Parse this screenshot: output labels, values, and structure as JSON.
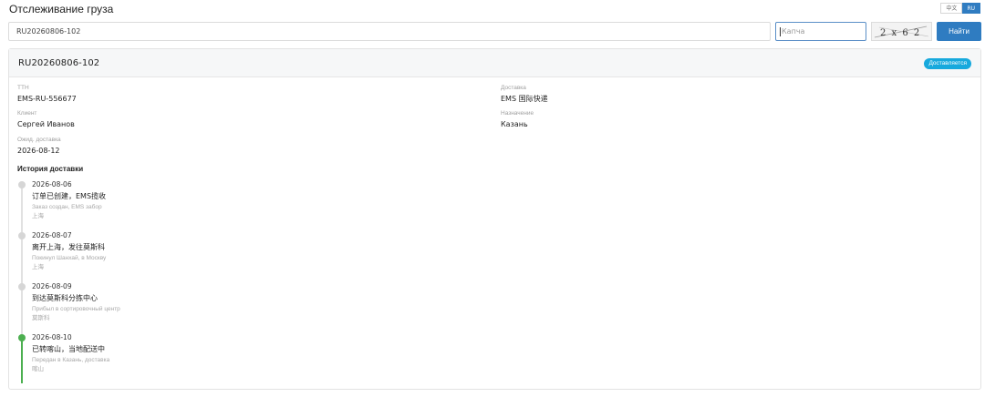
{
  "header": {
    "title": "Отслеживание груза"
  },
  "language": {
    "options": [
      "中文",
      "RU"
    ],
    "active": "RU"
  },
  "search": {
    "value": "RU20260806-102",
    "captcha_placeholder": "Капча",
    "captcha_code": "2 x 6 2",
    "button_label": "Найти"
  },
  "result": {
    "tracking_number": "RU20260806-102",
    "status": "Доставляется",
    "fields": {
      "ttn": {
        "label": "ТТН",
        "value": "EMS-RU-556677"
      },
      "delivery": {
        "label": "Доставка",
        "value": "EMS 国际快递"
      },
      "client": {
        "label": "Клиент",
        "value": "Сергей Иванов"
      },
      "destination": {
        "label": "Назначение",
        "value": "Казань"
      },
      "eta": {
        "label": "Ожид. доставка",
        "value": "2026-08-12"
      }
    },
    "history_title": "История доставки",
    "events": [
      {
        "date": "2026-08-06",
        "title": "订单已创建，EMS揽收",
        "description": "Заказ создан, EMS забор",
        "location": "上海",
        "current": false
      },
      {
        "date": "2026-08-07",
        "title": "离开上海，发往莫斯科",
        "description": "Покинул Шанхай, в Москву",
        "location": "上海",
        "current": false
      },
      {
        "date": "2026-08-09",
        "title": "到达莫斯科分拣中心",
        "description": "Прибыл в сортировочный центр",
        "location": "莫斯科",
        "current": false
      },
      {
        "date": "2026-08-10",
        "title": "已转喀山，当地配送中",
        "description": "Передан в Казань, доставка",
        "location": "喀山",
        "current": true
      }
    ]
  },
  "colors": {
    "primary": "#2f7cc1",
    "status_badge": "#17a9dd",
    "timeline_active": "#4caf50",
    "timeline_inactive": "#e1e1e1"
  },
  "icons": {
    "captcha_image": "captcha-image"
  }
}
